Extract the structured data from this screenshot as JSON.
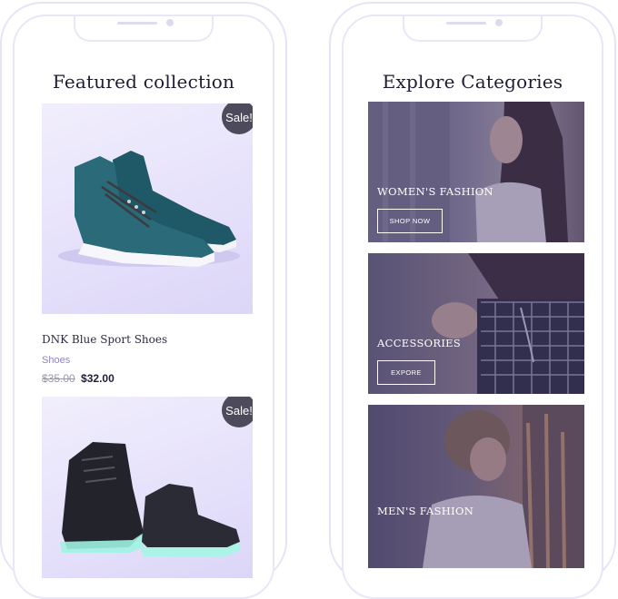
{
  "featured": {
    "title": "Featured collection",
    "products": [
      {
        "badge": "Sale!",
        "name": "DNK Blue Sport Shoes",
        "category": "Shoes",
        "old_price": "$35.00",
        "price": "$32.00"
      },
      {
        "badge": "Sale!"
      }
    ]
  },
  "categories": {
    "title": "Explore Categories",
    "items": [
      {
        "label": "WOMEN'S FASHION",
        "button": "SHOP NOW"
      },
      {
        "label": "ACCESSORIES",
        "button": "EXPORE"
      },
      {
        "label": "MEN'S FASHION"
      }
    ]
  }
}
